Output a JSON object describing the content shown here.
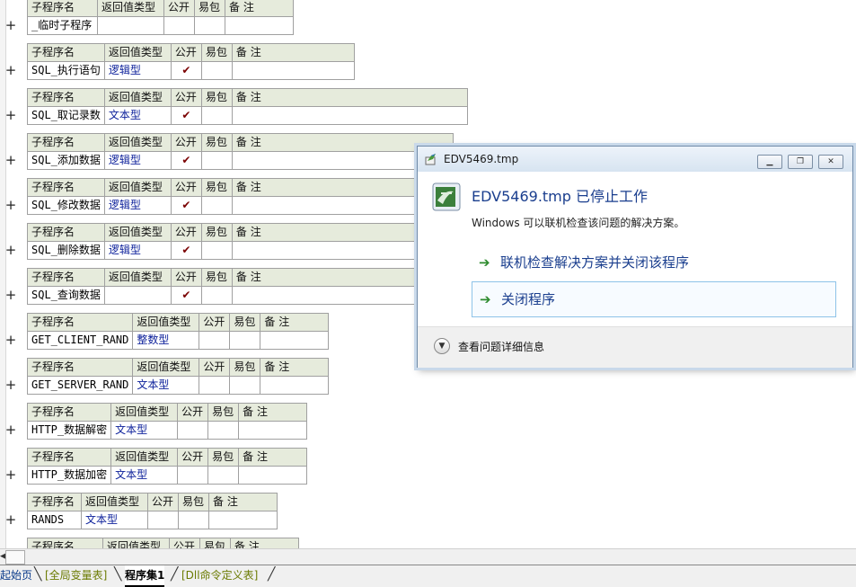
{
  "editor": {
    "subprograms": [
      {
        "name": "_临时子程序",
        "ret": "",
        "public": false
      },
      {
        "name": "SQL_执行语句",
        "ret": "逻辑型",
        "public": true
      },
      {
        "name": "SQL_取记录数",
        "ret": "文本型",
        "public": true
      },
      {
        "name": "SQL_添加数据",
        "ret": "逻辑型",
        "public": true
      },
      {
        "name": "SQL_修改数据",
        "ret": "逻辑型",
        "public": true
      },
      {
        "name": "SQL_删除数据",
        "ret": "逻辑型",
        "public": true
      },
      {
        "name": "SQL_查询数据",
        "ret": "",
        "public": true
      },
      {
        "name": "GET_CLIENT_RAND",
        "ret": "整数型",
        "public": false
      },
      {
        "name": "GET_SERVER_RAND",
        "ret": "文本型",
        "public": false
      },
      {
        "name": "HTTP_数据解密",
        "ret": "文本型",
        "public": false
      },
      {
        "name": "HTTP_数据加密",
        "ret": "文本型",
        "public": false
      },
      {
        "name": "RANDS",
        "ret": "文本型",
        "public": false
      },
      {
        "name": "",
        "ret": "",
        "public": false
      }
    ],
    "headers": {
      "name": "子程序名",
      "ret": "返回值类型",
      "public": "公开",
      "easy": "易包",
      "note": "备 注"
    },
    "expand_symbol": "+",
    "check_symbol": "✔"
  },
  "tabs": [
    {
      "label": "起始页"
    },
    {
      "label": "[全局变量表]"
    },
    {
      "label": "程序集1"
    },
    {
      "label": "[Dll命令定义表]"
    }
  ],
  "dialog": {
    "title": "EDV5469.tmp",
    "heading": "EDV5469.tmp 已停止工作",
    "subtext": "Windows 可以联机检查该问题的解决方案。",
    "option1": "联机检查解决方案并关闭该程序",
    "option2": "关闭程序",
    "details": "查看问题详细信息",
    "icons": {
      "app": "app-icon",
      "minimize": "minimize-icon",
      "restore": "restore-icon",
      "close": "close-icon",
      "arrow": "green-arrow-icon",
      "chevron": "chevron-down-icon"
    }
  }
}
